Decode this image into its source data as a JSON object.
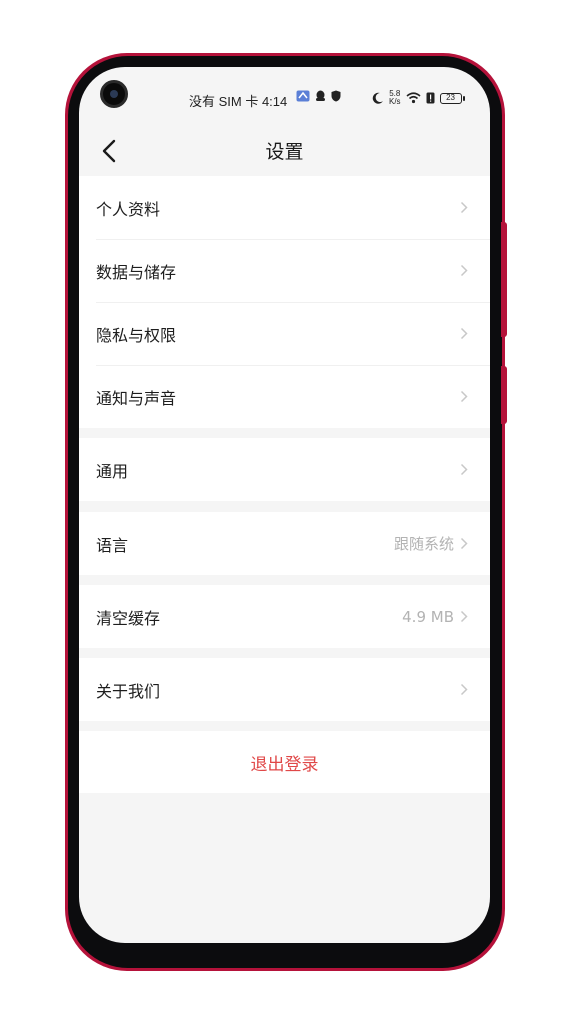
{
  "status_bar": {
    "carrier_time": "没有 SIM 卡 4:14",
    "net_speed_value": "5.8",
    "net_speed_unit": "K/s",
    "battery": "23"
  },
  "nav": {
    "title": "设置"
  },
  "groups": [
    {
      "items": [
        {
          "label": "个人资料",
          "value": ""
        },
        {
          "label": "数据与储存",
          "value": ""
        },
        {
          "label": "隐私与权限",
          "value": ""
        },
        {
          "label": "通知与声音",
          "value": ""
        }
      ]
    },
    {
      "items": [
        {
          "label": "通用",
          "value": ""
        }
      ]
    },
    {
      "items": [
        {
          "label": "语言",
          "value": "跟随系统"
        }
      ]
    },
    {
      "items": [
        {
          "label": "清空缓存",
          "value": "4.9 MB"
        }
      ]
    },
    {
      "items": [
        {
          "label": "关于我们",
          "value": ""
        }
      ]
    }
  ],
  "logout_label": "退出登录",
  "colors": {
    "frame": "#b5123a",
    "background": "#f5f5f5",
    "logout_text": "#e04848",
    "secondary_text": "#b3b3b3"
  }
}
